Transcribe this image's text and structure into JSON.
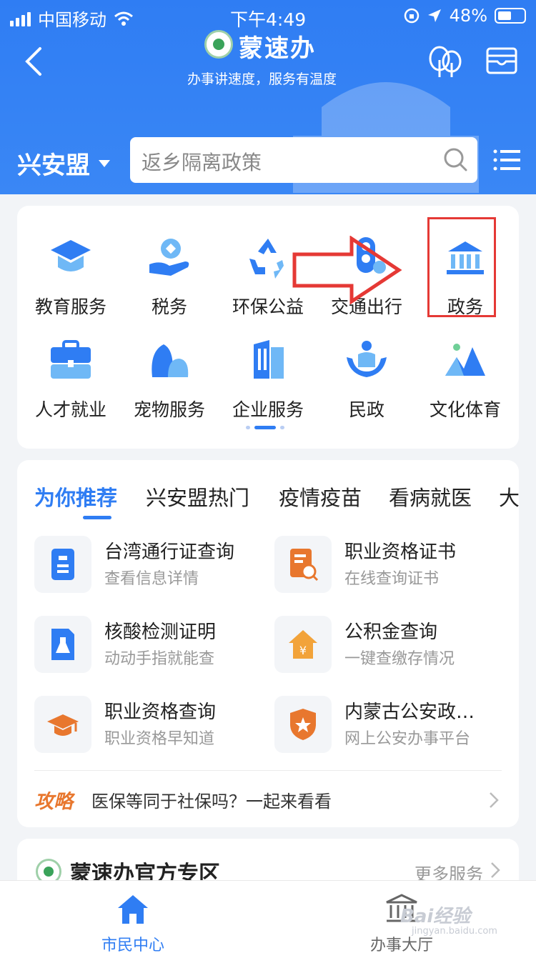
{
  "status_bar": {
    "carrier": "中国移动",
    "time": "下午4:49",
    "battery": "48%"
  },
  "header": {
    "brand": "蒙速办",
    "slogan": "办事讲速度，服务有温度",
    "city": "兴安盟"
  },
  "search": {
    "placeholder": "返乡隔离政策"
  },
  "services": [
    {
      "label": "教育服务",
      "icon": "mortarboard-icon"
    },
    {
      "label": "税务",
      "icon": "hand-coin-icon"
    },
    {
      "label": "环保公益",
      "icon": "recycle-icon"
    },
    {
      "label": "交通出行",
      "icon": "traffic-light-icon"
    },
    {
      "label": "政务",
      "icon": "government-building-icon"
    },
    {
      "label": "人才就业",
      "icon": "briefcase-icon"
    },
    {
      "label": "宠物服务",
      "icon": "pet-icon"
    },
    {
      "label": "企业服务",
      "icon": "office-building-icon"
    },
    {
      "label": "民政",
      "icon": "family-care-icon"
    },
    {
      "label": "文化体育",
      "icon": "mountain-icon"
    }
  ],
  "recommend": {
    "tabs": [
      "为你推荐",
      "兴安盟热门",
      "疫情疫苗",
      "看病就医",
      "大"
    ],
    "items": [
      {
        "title": "台湾通行证查询",
        "subtitle": "查看信息详情",
        "icon": "id-card-icon"
      },
      {
        "title": "职业资格证书",
        "subtitle": "在线查询证书",
        "icon": "certificate-search-icon"
      },
      {
        "title": "核酸检测证明",
        "subtitle": "动动手指就能查",
        "icon": "flask-document-icon"
      },
      {
        "title": "公积金查询",
        "subtitle": "一键查缴存情况",
        "icon": "house-yuan-icon"
      },
      {
        "title": "职业资格查询",
        "subtitle": "职业资格早知道",
        "icon": "graduation-cap-icon"
      },
      {
        "title": "内蒙古公安政…",
        "subtitle": "网上公安办事平台",
        "icon": "police-shield-icon"
      }
    ],
    "guide": {
      "tag": "攻略",
      "text": "医保等同于社保吗？一起来看看"
    }
  },
  "official": {
    "title": "蒙速办官方专区",
    "more": "更多服务"
  },
  "tabbar": [
    {
      "label": "市民中心",
      "icon": "home-icon"
    },
    {
      "label": "办事大厅",
      "icon": "hall-icon"
    }
  ],
  "watermark": {
    "main": "Bai经验",
    "sub": "jingyan.baidu.com"
  },
  "colors": {
    "primary": "#2f7df3",
    "accent_orange": "#e8772e",
    "highlight_red": "#e53935"
  }
}
